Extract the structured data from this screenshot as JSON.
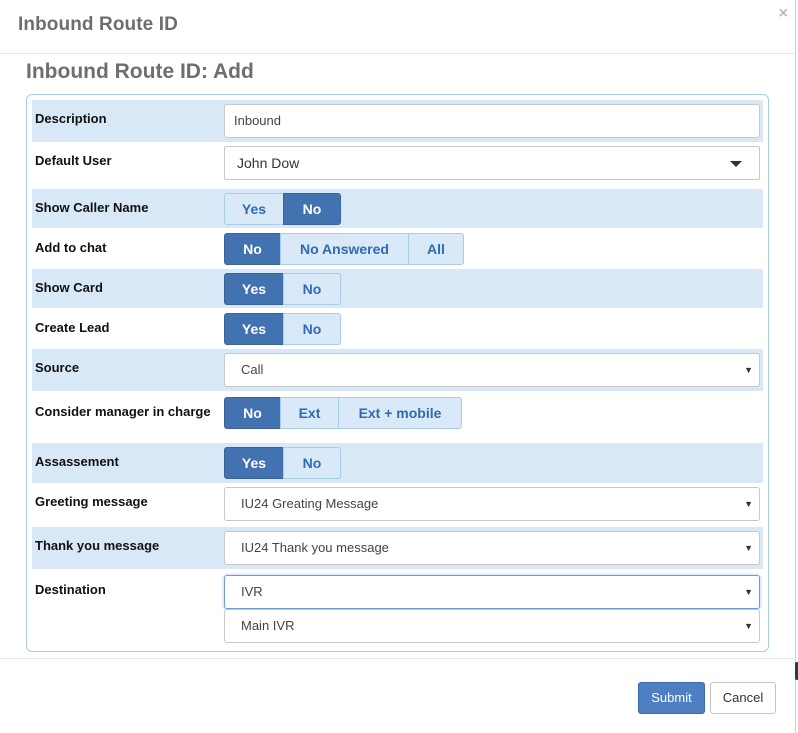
{
  "modal": {
    "title": "Inbound Route ID",
    "close_label": "×"
  },
  "form": {
    "title": "Inbound Route ID: Add",
    "description": {
      "label": "Description",
      "value": "Inbound"
    },
    "default_user": {
      "label": "Default User",
      "value": "John Dow"
    },
    "show_caller_name": {
      "label": "Show Caller Name",
      "options": [
        "Yes",
        "No"
      ],
      "selected": "No"
    },
    "add_to_chat": {
      "label": "Add to chat",
      "options": [
        "No",
        "No Answered",
        "All"
      ],
      "selected": "No"
    },
    "show_card": {
      "label": "Show Card",
      "options": [
        "Yes",
        "No"
      ],
      "selected": "Yes"
    },
    "create_lead": {
      "label": "Create Lead",
      "options": [
        "Yes",
        "No"
      ],
      "selected": "Yes"
    },
    "source": {
      "label": "Source",
      "value": "Call"
    },
    "consider_manager": {
      "label": "Consider manager in charge",
      "options": [
        "No",
        "Ext",
        "Ext + mobile"
      ],
      "selected": "No"
    },
    "assassement": {
      "label": "Assassement",
      "options": [
        "Yes",
        "No"
      ],
      "selected": "Yes"
    },
    "greeting_message": {
      "label": "Greeting message",
      "value": "IU24 Greating Message"
    },
    "thank_you_message": {
      "label": "Thank you message",
      "value": "IU24 Thank you message"
    },
    "destination": {
      "label": "Destination",
      "type_value": "IVR",
      "target_value": "Main IVR"
    }
  },
  "footer": {
    "submit_label": "Submit",
    "cancel_label": "Cancel"
  },
  "colors": {
    "accent": "#4372b1",
    "row_shade": "#d9e8f6",
    "panel_border": "#a9cde6"
  }
}
